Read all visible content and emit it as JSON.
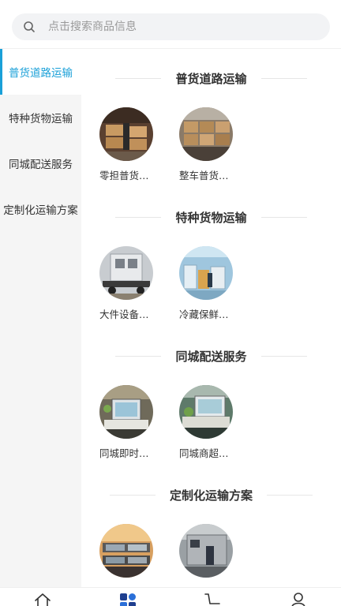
{
  "search": {
    "placeholder": "点击搜索商品信息",
    "icon": "search-icon"
  },
  "sidebar": {
    "active_color": "#1aa0d8",
    "items": [
      {
        "label": "普货道路运输",
        "active": true
      },
      {
        "label": "特种货物运输",
        "active": false
      },
      {
        "label": "同城配送服务",
        "active": false
      },
      {
        "label": "定制化运输方案",
        "active": false
      }
    ]
  },
  "sections": [
    {
      "title": "普货道路运输",
      "items": [
        {
          "label": "零担普货…"
        },
        {
          "label": "整车普货…"
        }
      ]
    },
    {
      "title": "特种货物运输",
      "items": [
        {
          "label": "大件设备…"
        },
        {
          "label": "冷藏保鲜…"
        }
      ]
    },
    {
      "title": "同城配送服务",
      "items": [
        {
          "label": "同城即时…"
        },
        {
          "label": "同城商超…"
        }
      ]
    },
    {
      "title": "定制化运输方案",
      "items": [
        {
          "label": ""
        },
        {
          "label": ""
        }
      ]
    }
  ],
  "tabbar": {
    "tabs": [
      {
        "icon": "home-icon"
      },
      {
        "icon": "category-icon",
        "active": true
      },
      {
        "icon": "cart-icon"
      },
      {
        "icon": "profile-icon"
      }
    ]
  }
}
